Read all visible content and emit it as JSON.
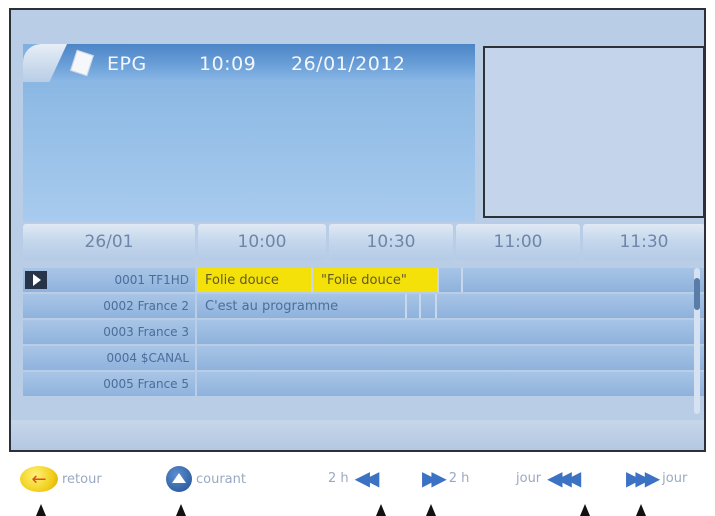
{
  "header": {
    "label": "EPG",
    "time": "10:09",
    "date": "26/01/2012"
  },
  "timeline": {
    "date": "26/01",
    "slots": [
      "10:00",
      "10:30",
      "11:00",
      "11:30"
    ]
  },
  "channels": [
    {
      "number": "0001",
      "name": "TF1HD",
      "selected": true,
      "programs": [
        {
          "title": "Folie douce",
          "highlight": true
        },
        {
          "title": "\"Folie douce\"",
          "highlight": true
        },
        {
          "title": "",
          "highlight": false
        },
        {
          "title": "",
          "highlight": false
        }
      ]
    },
    {
      "number": "0002",
      "name": "France 2",
      "selected": false,
      "programs": [
        {
          "title": "C'est au programme",
          "highlight": false
        },
        {
          "title": "",
          "highlight": false
        },
        {
          "title": "",
          "highlight": false
        }
      ]
    },
    {
      "number": "0003",
      "name": "France 3",
      "selected": false,
      "programs": []
    },
    {
      "number": "0004",
      "name": "$CANAL",
      "selected": false,
      "programs": []
    },
    {
      "number": "0005",
      "name": "France 5",
      "selected": false,
      "programs": []
    }
  ],
  "legend": {
    "back_label": "retour",
    "current_label": "courant",
    "minus2h_label": "2 h",
    "plus2h_label": "2 h",
    "prevday_label": "jour",
    "nextday_label": "jour"
  },
  "icons": {
    "back": "left-arrow-icon",
    "current": "up-triangle-icon",
    "rewind": "double-left-arrow-icon",
    "forward": "double-right-arrow-icon",
    "fast_rewind": "triple-left-arrow-icon",
    "fast_forward": "triple-right-arrow-icon"
  },
  "colors": {
    "highlight": "#f5e10a",
    "background": "#bacde6",
    "accent": "#3b72c3"
  }
}
